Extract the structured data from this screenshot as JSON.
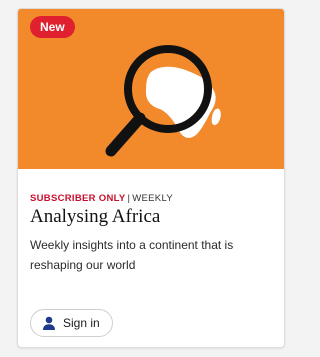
{
  "card": {
    "badge": "New",
    "image": {
      "icon": "magnifier-over-africa-icon",
      "background": "#f28a2c"
    },
    "meta": {
      "access": "SUBSCRIBER ONLY",
      "separator": "|",
      "frequency": "WEEKLY"
    },
    "title": "Analysing Africa",
    "description": "Weekly insights into a continent that is reshaping our world",
    "sign_in": {
      "icon": "user-icon",
      "label": "Sign in"
    }
  },
  "colors": {
    "badge": "#e0202f",
    "access_text": "#c8102e",
    "icon_blue": "#1f3a8a"
  }
}
